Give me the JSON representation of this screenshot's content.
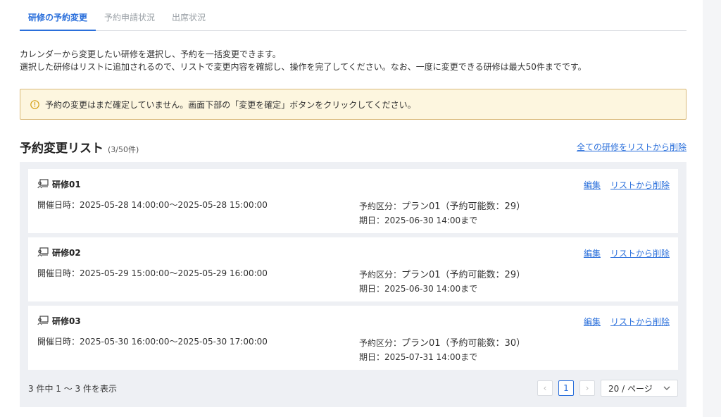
{
  "tabs": [
    {
      "label": "研修の予約変更"
    },
    {
      "label": "予約申請状況"
    },
    {
      "label": "出席状況"
    }
  ],
  "description": {
    "line1": "カレンダーから変更したい研修を選択し、予約を一括変更できます。",
    "line2": "選択した研修はリストに追加されるので、リストで変更内容を確認し、操作を完了してください。なお、一度に変更できる研修は最大50件までです。"
  },
  "notice": {
    "text": "予約の変更はまだ確定していません。画面下部の「変更を確定」ボタンをクリックしてください。",
    "icon": "warning-circle-icon",
    "accent": "#d9b978",
    "background": "#fdf6df"
  },
  "list": {
    "title": "予約変更リスト",
    "count": "(3/50件)",
    "remove_all_label": "全ての研修をリストから削除",
    "items": [
      {
        "name": "研修01",
        "datetime": "開催日時：2025-05-28 14:00:00～2025-05-28 15:00:00",
        "plan_label": "予約区分：",
        "plan_value": "プラン01（予約可能数：29）",
        "due": "期日：2025-06-30 14:00まで",
        "edit_label": "編集",
        "remove_label": "リストから削除"
      },
      {
        "name": "研修02",
        "datetime": "開催日時：2025-05-29 15:00:00～2025-05-29 16:00:00",
        "plan_label": "予約区分：",
        "plan_value": "プラン01（予約可能数：29）",
        "due": "期日：2025-06-30 14:00まで",
        "edit_label": "編集",
        "remove_label": "リストから削除"
      },
      {
        "name": "研修03",
        "datetime": "開催日時：2025-05-30 16:00:00～2025-05-30 17:00:00",
        "plan_label": "予約区分：",
        "plan_value": "プラン01（予約可能数：30）",
        "due": "期日：2025-07-31 14:00まで",
        "edit_label": "編集",
        "remove_label": "リストから削除"
      }
    ]
  },
  "pagination": {
    "info": "3 件中 1 ～ 3 件を表示",
    "prev": "‹",
    "current_page": "1",
    "next": "›",
    "page_size": "20 / ページ"
  },
  "colors": {
    "accent": "#2a6fdb",
    "panel": "#eef0f4"
  }
}
